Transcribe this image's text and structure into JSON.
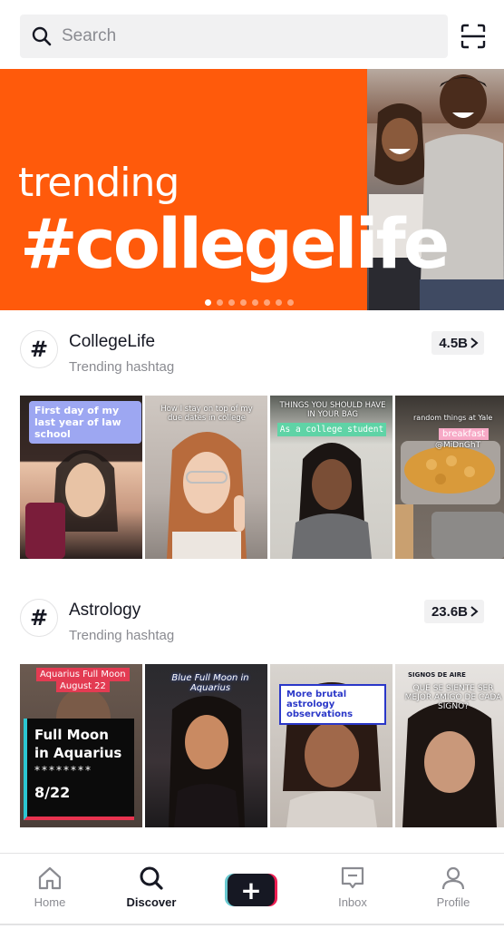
{
  "search": {
    "placeholder": "Search",
    "icon": "search-icon",
    "scan_icon": "scan-icon"
  },
  "banner": {
    "line1": "trending",
    "line2": "#collegelife",
    "background": "#ff5a0b",
    "dots_count": 8,
    "active_dot": 0
  },
  "sections": [
    {
      "title": "CollegeLife",
      "subtitle": "Trending hashtag",
      "count": "4.5B",
      "videos": [
        {
          "caption": "First day of my last year of law school"
        },
        {
          "caption": "How I stay on top of my due dates in college"
        },
        {
          "caption": "THINGS YOU SHOULD HAVE IN YOUR BAG",
          "caption2": "As a college student"
        },
        {
          "caption": "random things at Yale",
          "caption2": "breakfast",
          "caption3": "@MiDnGhT"
        }
      ]
    },
    {
      "title": "Astrology",
      "subtitle": "Trending hashtag",
      "count": "23.6B",
      "videos": [
        {
          "caption": "Aquarius Full Moon",
          "caption2": "August 22",
          "caption3": "Full Moon in Aquarius",
          "caption4": "********",
          "caption5": "8/22"
        },
        {
          "caption": "Blue Full Moon in Aquarius"
        },
        {
          "caption": "More brutal astrology observations"
        },
        {
          "caption": "SIGNOS DE AIRE",
          "caption2": "QUE SE SIENTE SER MEJOR AMIGO DE CADA SIGNO?"
        }
      ]
    }
  ],
  "nav": {
    "home": "Home",
    "discover": "Discover",
    "inbox": "Inbox",
    "profile": "Profile",
    "active": "discover"
  }
}
